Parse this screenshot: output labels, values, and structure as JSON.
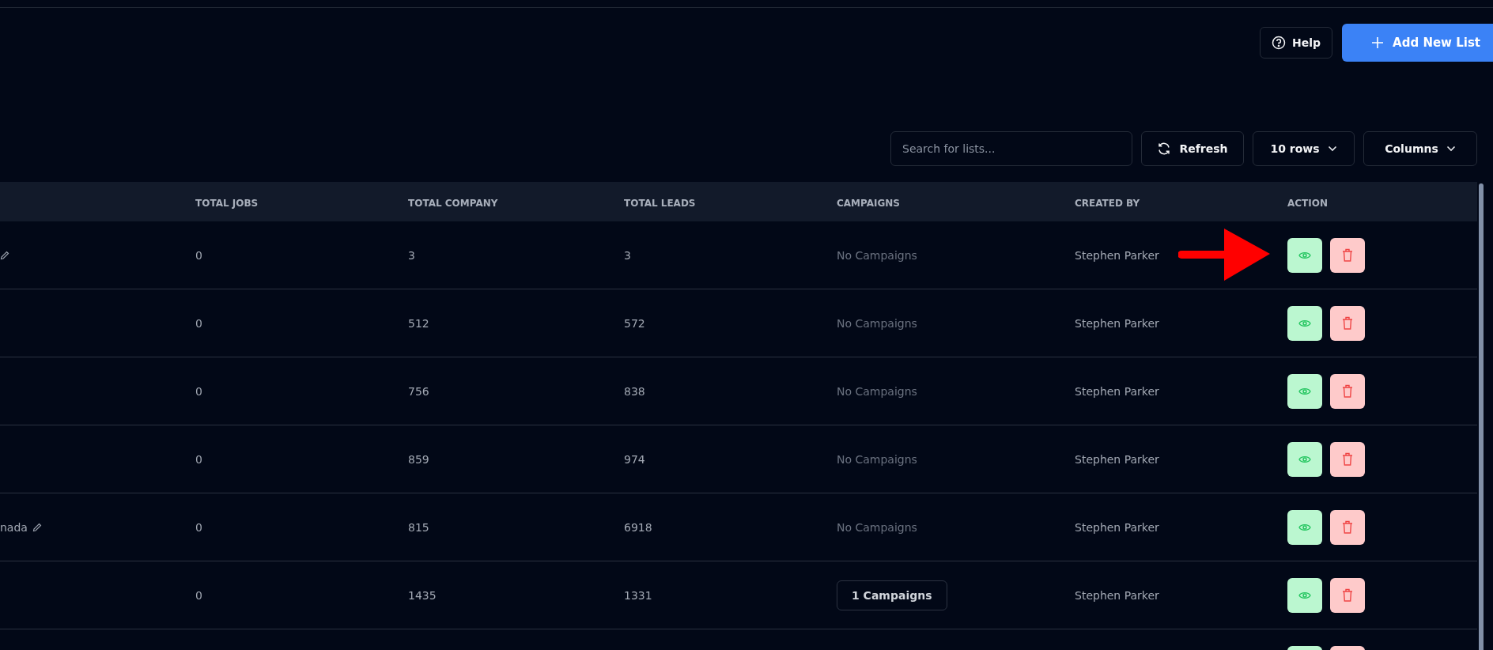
{
  "header_buttons": [
    {
      "label": "Help",
      "kind": "help"
    },
    {
      "label": "Add New List",
      "kind": "add"
    }
  ],
  "toolbar": {
    "search": {
      "placeholder": "Search for lists..."
    },
    "refresh": "Refresh",
    "rows": "10 rows",
    "columns": "Columns"
  },
  "table": {
    "columns": [
      "TOTAL JOBS",
      "TOTAL COMPANY",
      "TOTAL LEADS",
      "CAMPAIGNS",
      "CREATED BY",
      "ACTION"
    ],
    "rows": [
      {
        "name_editable": true,
        "total_jobs": "0",
        "total_company": "3",
        "total_leads": "3",
        "campaigns": {
          "kind": "none",
          "text": "No Campaigns"
        },
        "created_by": "Stephen Parker"
      },
      {
        "total_jobs": "0",
        "total_company": "512",
        "total_leads": "572",
        "campaigns": {
          "kind": "none",
          "text": "No Campaigns"
        },
        "created_by": "Stephen Parker"
      },
      {
        "total_jobs": "0",
        "total_company": "756",
        "total_leads": "838",
        "campaigns": {
          "kind": "none",
          "text": "No Campaigns"
        },
        "created_by": "Stephen Parker"
      },
      {
        "total_jobs": "0",
        "total_company": "859",
        "total_leads": "974",
        "campaigns": {
          "kind": "none",
          "text": "No Campaigns"
        },
        "created_by": "Stephen Parker"
      },
      {
        "name": "nada",
        "name_editable": true,
        "total_jobs": "0",
        "total_company": "815",
        "total_leads": "6918",
        "campaigns": {
          "kind": "none",
          "text": "No Campaigns"
        },
        "created_by": "Stephen Parker"
      },
      {
        "total_jobs": "0",
        "total_company": "1435",
        "total_leads": "1331",
        "campaigns": {
          "kind": "link",
          "text": "1 Campaigns"
        },
        "created_by": "Stephen Parker"
      },
      {}
    ]
  }
}
